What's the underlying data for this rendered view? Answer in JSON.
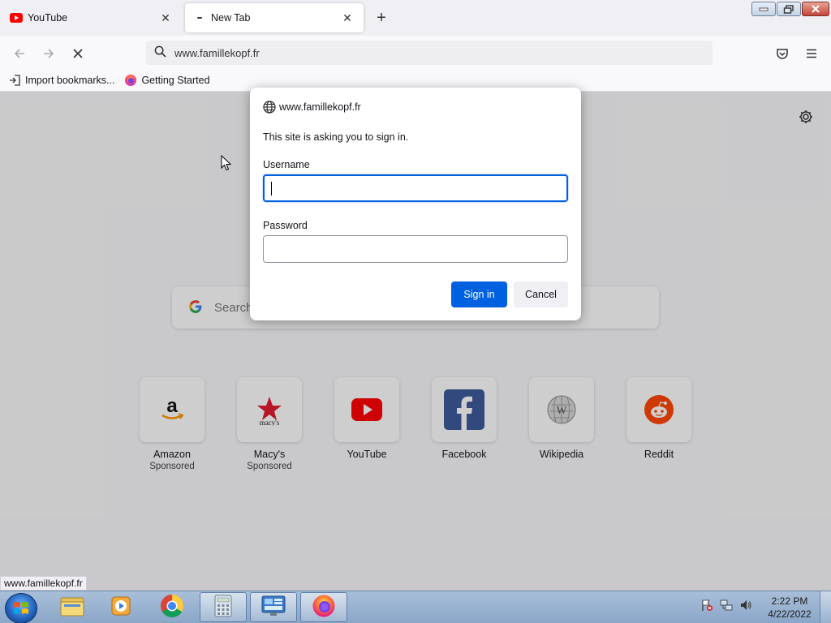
{
  "tabs": [
    {
      "label": "YouTube",
      "active": false,
      "favicon": "youtube-icon"
    },
    {
      "label": "New Tab",
      "active": true,
      "favicon": "loading-icon"
    }
  ],
  "urlbar": {
    "value": "www.famillekopf.fr"
  },
  "bookmarks": [
    {
      "label": "Import bookmarks...",
      "icon": "import-icon"
    },
    {
      "label": "Getting Started",
      "icon": "firefox-icon"
    }
  ],
  "newtab": {
    "search_placeholder": "Search",
    "tiles": [
      {
        "label": "Amazon",
        "sub": "Sponsored",
        "icon": "amazon-icon"
      },
      {
        "label": "Macy's",
        "sub": "Sponsored",
        "icon": "macys-icon"
      },
      {
        "label": "YouTube",
        "sub": "",
        "icon": "youtube-icon"
      },
      {
        "label": "Facebook",
        "sub": "",
        "icon": "facebook-icon"
      },
      {
        "label": "Wikipedia",
        "sub": "",
        "icon": "wikipedia-icon"
      },
      {
        "label": "Reddit",
        "sub": "",
        "icon": "reddit-icon"
      }
    ]
  },
  "dialog": {
    "site": "www.famillekopf.fr",
    "message": "This site is asking you to sign in.",
    "username_label": "Username",
    "username_value": "",
    "password_label": "Password",
    "password_value": "",
    "sign_in_label": "Sign in",
    "cancel_label": "Cancel"
  },
  "status_bar": {
    "url": "www.famillekopf.fr"
  },
  "taskbar": {
    "time": "2:22 PM",
    "date": "4/22/2022"
  },
  "colors": {
    "accent": "#0061e0",
    "youtube": "#ff0000",
    "facebook": "#3b5998",
    "reddit": "#ff4500"
  }
}
